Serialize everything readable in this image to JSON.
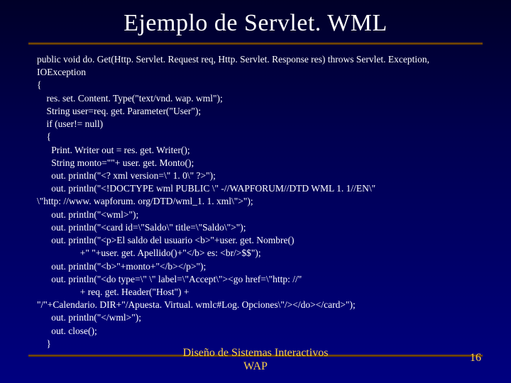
{
  "title": "Ejemplo de Servlet. WML",
  "code": "public void do. Get(Http. Servlet. Request req, Http. Servlet. Response res) throws Servlet. Exception,\nIOException\n{\n    res. set. Content. Type(\"text/vnd. wap. wml\");\n    String user=req. get. Parameter(\"User\");\n    if (user!= null)\n    {\n      Print. Writer out = res. get. Writer();\n      String monto=\"\"+ user. get. Monto();\n      out. println(\"<? xml version=\\\" 1. 0\\\" ?>\");\n      out. println(\"<!DOCTYPE wml PUBLIC \\\" -//WAPFORUM//DTD WML 1. 1//EN\\\"\n\\\"http: //www. wapforum. org/DTD/wml_1. 1. xml\\\">\");\n      out. println(\"<wml>\");\n      out. println(\"<card id=\\\"Saldo\\\" title=\\\"Saldo\\\">\");\n      out. println(\"<p>El saldo del usuario <b>\"+user. get. Nombre()\n                  +\" \"+user. get. Apellido()+\"</b> es: <br/>$$\");\n      out. println(\"<b>\"+monto+\"</b></p>\");\n      out. println(\"<do type=\\\" \\\" label=\\\"Accept\\\"><go href=\\\"http: //\"\n                  + req. get. Header(\"Host\") +\n\"/\"+Calendario. DIR+\"/Apuesta. Virtual. wmlc#Log. Opciones\\\"/></do></card>\");\n      out. println(\"</wml>\");\n      out. close();\n    }",
  "footer": {
    "line1": "Diseño de Sistemas Interactivos",
    "line2": "WAP"
  },
  "page_number": "16"
}
